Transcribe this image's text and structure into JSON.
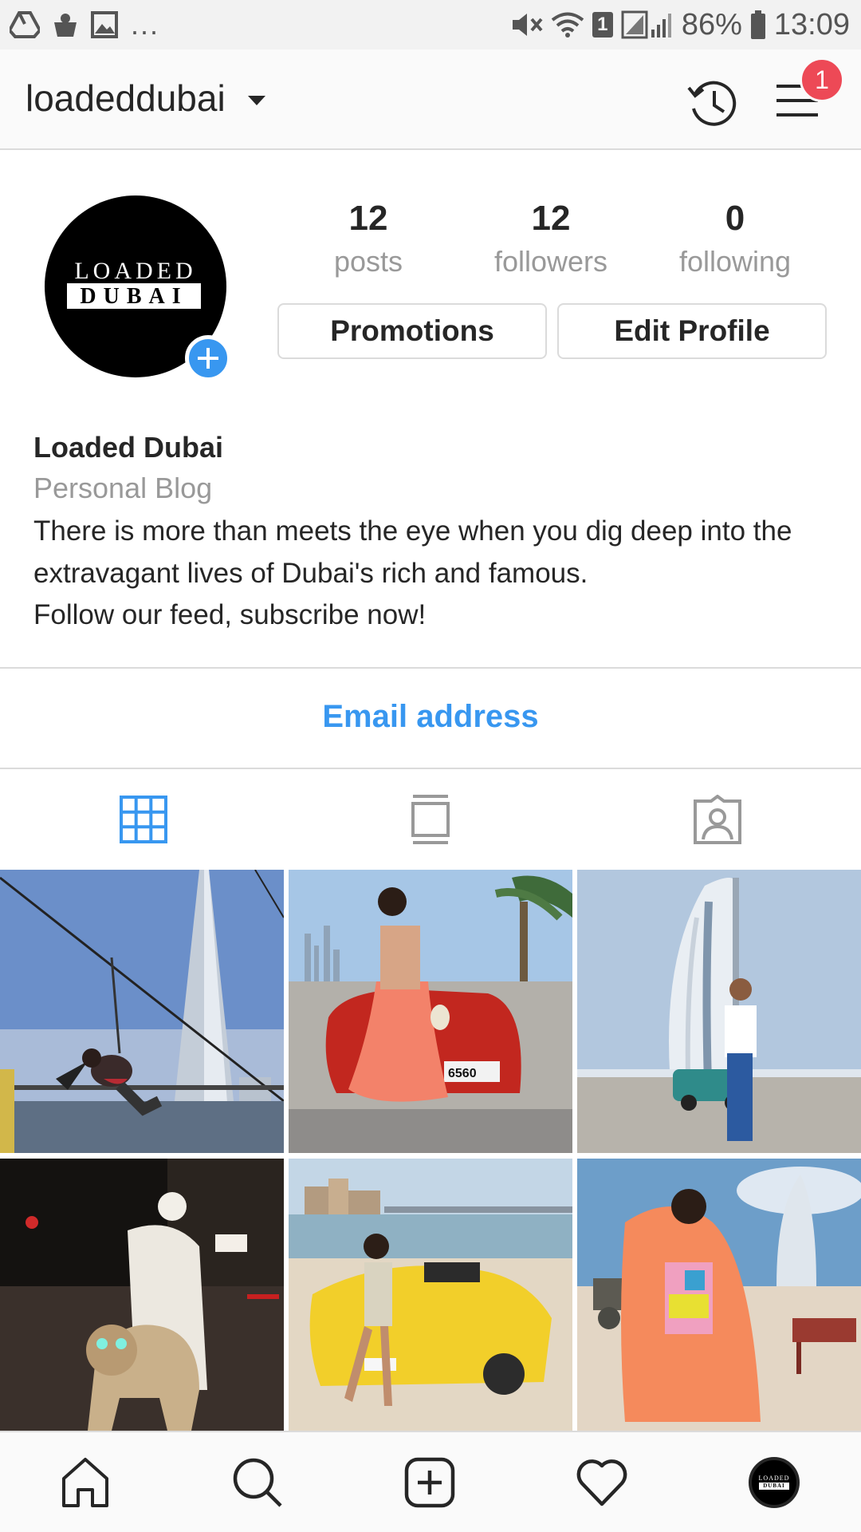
{
  "status_bar": {
    "overflow": "...",
    "notif_count": "1",
    "battery_percent": "86%",
    "time": "13:09",
    "left_icons": [
      "drive-icon",
      "cloud-icon",
      "gallery-icon"
    ],
    "right_icons": [
      "mute-icon",
      "wifi-icon",
      "sim-icon",
      "signal-icon",
      "battery-icon"
    ]
  },
  "header": {
    "username": "loadeddubai",
    "notification_badge": "1",
    "icons": [
      "chevron-down-icon",
      "history-icon",
      "menu-icon"
    ]
  },
  "profile": {
    "avatar_logo": {
      "line1": "LOADED",
      "line2": "DUBAI"
    },
    "stats": [
      {
        "value": "12",
        "label": "posts"
      },
      {
        "value": "12",
        "label": "followers"
      },
      {
        "value": "0",
        "label": "following"
      }
    ],
    "buttons": {
      "promotions": "Promotions",
      "edit_profile": "Edit Profile"
    },
    "name": "Loaded Dubai",
    "category": "Personal Blog",
    "bio_lines": [
      "There is more than meets the eye when you dig deep into the",
      "extravagant lives of Dubai's rich and famous.",
      "Follow our feed, subscribe now!"
    ],
    "contact": "Email address"
  },
  "tabs": [
    {
      "icon": "grid-icon",
      "active": true
    },
    {
      "icon": "feed-icon",
      "active": false
    },
    {
      "icon": "tagged-icon",
      "active": false
    }
  ],
  "grid_posts": [
    {
      "id": "post-zipline-burj-khalifa",
      "vehicle_plate": ""
    },
    {
      "id": "post-woman-red-ferrari",
      "vehicle_plate": "6560"
    },
    {
      "id": "post-man-burj-al-arab",
      "vehicle_plate": ""
    },
    {
      "id": "post-man-riding-lion",
      "vehicle_plate": ""
    },
    {
      "id": "post-woman-yellow-ferrari",
      "vehicle_plate": ""
    },
    {
      "id": "post-woman-beach-burj-al-arab",
      "vehicle_plate": ""
    }
  ],
  "bottom_nav": [
    "home-icon",
    "search-icon",
    "new-post-icon",
    "activity-heart-icon",
    "profile-avatar-icon"
  ],
  "colors": {
    "accent": "#3897f0",
    "badge": "#ed4956",
    "text": "#262626",
    "muted": "#999999",
    "border": "#dbdbdb"
  }
}
